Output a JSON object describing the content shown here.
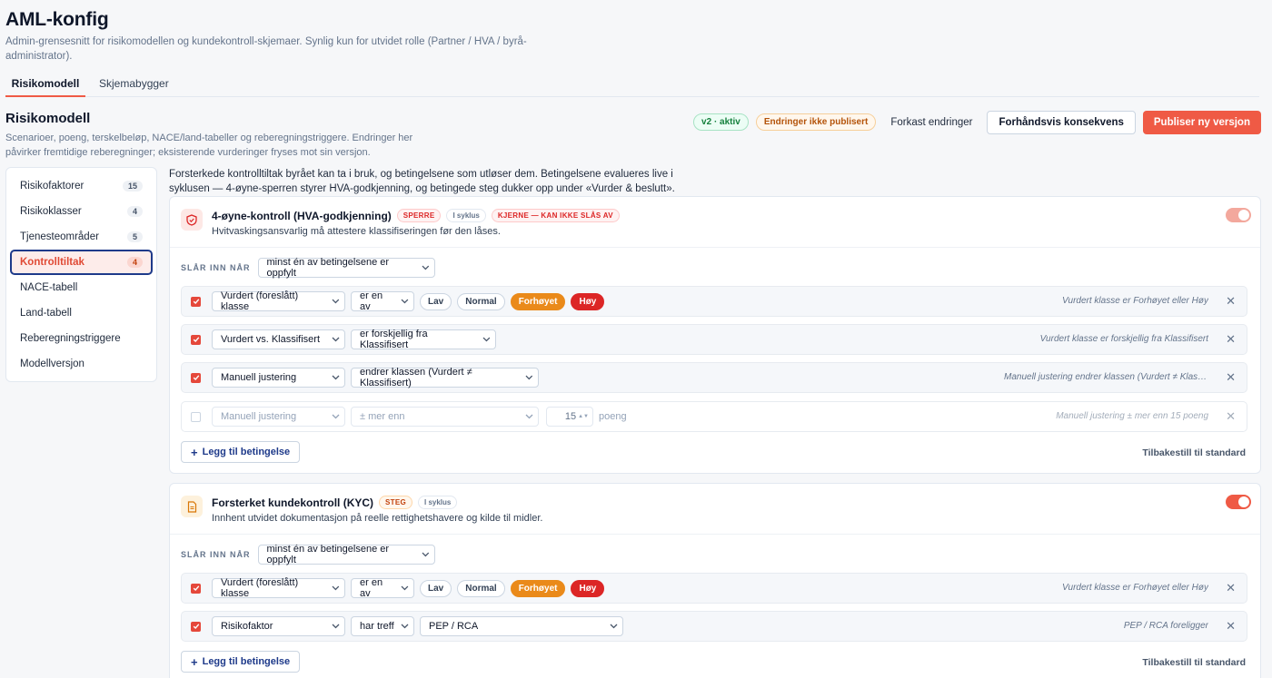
{
  "app": {
    "title": "AML-konfig",
    "subtitle": "Admin-grensesnitt for risikomodellen og kundekontroll-skjemaer. Synlig kun for utvidet rolle (Partner / HVA / byrå-administrator)."
  },
  "tabs": [
    {
      "label": "Risikomodell",
      "active": true
    },
    {
      "label": "Skjemabygger",
      "active": false
    }
  ],
  "section": {
    "title": "Risikomodell",
    "description": "Scenarioer, poeng, terskelbeløp, NACE/land-tabeller og reberegningstriggere. Endringer her påvirker fremtidige reberegninger; eksisterende vurderinger fryses mot sin versjon."
  },
  "header_actions": {
    "version_badge": "v2 · aktiv",
    "unpublished_badge": "Endringer ikke publisert",
    "discard": "Forkast endringer",
    "preview": "Forhåndsvis konsekvens",
    "publish": "Publiser ny versjon"
  },
  "sidebar": {
    "items": [
      {
        "label": "Risikofaktorer",
        "count": "15"
      },
      {
        "label": "Risikoklasser",
        "count": "4"
      },
      {
        "label": "Tjenesteområder",
        "count": "5"
      },
      {
        "label": "Kontrolltiltak",
        "count": "4",
        "active": true
      },
      {
        "label": "NACE-tabell",
        "count": ""
      },
      {
        "label": "Land-tabell",
        "count": ""
      },
      {
        "label": "Reberegningstriggere",
        "count": ""
      },
      {
        "label": "Modellversjon",
        "count": ""
      }
    ]
  },
  "intro": "Forsterkede kontrolltiltak byrået kan ta i bruk, og betingelsene som utløser dem. Betingelsene evalueres live i syklusen — 4-øyne-sperren styrer HVA-godkjenning, og betingede steg dukker opp under «Vurder & beslutt».",
  "cards": [
    {
      "title": "4-øyne-kontroll (HVA-godkjenning)",
      "tags": [
        "SPERRE",
        "I syklus",
        "KJERNE — KAN IKKE SLÅS AV"
      ],
      "subtitle": "Hvitvaskingsansvarlig må attestere klassifiseringen før den låses.",
      "enabled": true,
      "trigger_label": "SLÅR INN NÅR",
      "trigger_value": "minst én av betingelsene er oppfylt",
      "conditions": [
        {
          "field": "Vurdert (foreslått) klasse",
          "op": "er en av",
          "chips": [
            "Lav",
            "Normal",
            "Forhøyet",
            "Høy"
          ],
          "summary": "Vurdert klasse er Forhøyet eller Høy",
          "checked": true
        },
        {
          "field": "Vurdert vs. Klassifisert",
          "op": "er forskjellig fra Klassifisert",
          "summary": "Vurdert klasse er forskjellig fra Klassifisert",
          "checked": true
        },
        {
          "field": "Manuell justering",
          "op": "endrer klassen (Vurdert ≠ Klassifisert)",
          "summary": "Manuell justering endrer klassen (Vurdert ≠ Klassifisert)",
          "checked": true
        },
        {
          "field": "Manuell justering",
          "op": "± mer enn",
          "value": "15",
          "unit": "poeng",
          "summary": "Manuell justering ± mer enn 15 poeng",
          "checked": false
        }
      ],
      "add_label": "Legg til betingelse",
      "reset_label": "Tilbakestill til standard"
    },
    {
      "title": "Forsterket kundekontroll (KYC)",
      "tags": [
        "STEG",
        "I syklus"
      ],
      "subtitle": "Innhent utvidet dokumentasjon på reelle rettighetshavere og kilde til midler.",
      "enabled": true,
      "trigger_label": "SLÅR INN NÅR",
      "trigger_value": "minst én av betingelsene er oppfylt",
      "conditions": [
        {
          "field": "Vurdert (foreslått) klasse",
          "op": "er en av",
          "chips": [
            "Lav",
            "Normal",
            "Forhøyet",
            "Høy"
          ],
          "summary": "Vurdert klasse er Forhøyet eller Høy",
          "checked": true
        },
        {
          "field": "Risikofaktor",
          "op": "har treff",
          "value": "PEP / RCA",
          "summary": "PEP / RCA foreligger",
          "checked": true
        }
      ],
      "add_label": "Legg til betingelse",
      "reset_label": "Tilbakestill til standard"
    }
  ],
  "colors": {
    "accent": "#ef5a45",
    "selected_orange": "#ea8a1a",
    "selected_red": "#dc2626",
    "nav_focus": "#1e3a8a"
  },
  "icons": {
    "chevron": "chevron-down-icon",
    "close": "close-icon",
    "shield": "shield-icon",
    "document": "document-icon",
    "plus": "plus-icon",
    "check": "check-icon"
  }
}
